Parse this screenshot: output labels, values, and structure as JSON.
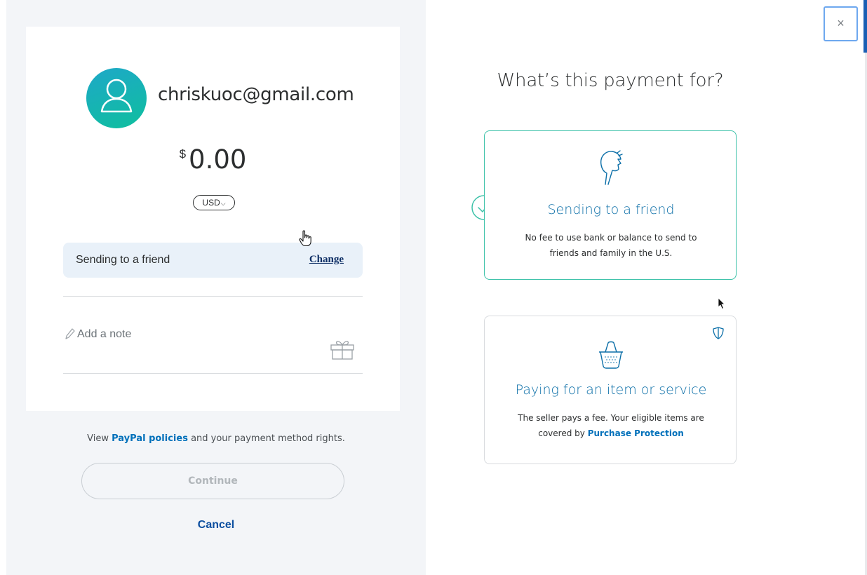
{
  "recipient": {
    "email": "chriskuoc@gmail.com"
  },
  "payment": {
    "currency_symbol": "$",
    "amount": "0.00",
    "currency": "USD"
  },
  "purpose": {
    "label": "Sending to a friend",
    "change_label": "Change"
  },
  "note": {
    "placeholder": "Add a note"
  },
  "footer": {
    "policy_prefix": "View ",
    "policy_link": "PayPal policies",
    "policy_suffix": " and your payment method rights.",
    "continue_label": "Continue",
    "cancel_label": "Cancel"
  },
  "purpose_picker": {
    "title": "What’s this payment for?",
    "options": [
      {
        "title": "Sending to a friend",
        "description_line1": "No fee to use bank or balance to send to",
        "description_line2": "friends and family in the U.S.",
        "selected": true,
        "icon": "friend-head-icon"
      },
      {
        "title": "Paying for an item or service",
        "description_line1": "The seller pays a fee. Your eligible items are",
        "description_line2_prefix": "covered by ",
        "description_link": "Purchase Protection",
        "selected": false,
        "icon": "shopping-basket-icon"
      }
    ]
  },
  "close_label": "×",
  "colors": {
    "accent_blue": "#0070ba",
    "teal_selected": "#3dc2a9",
    "panel_bg": "#f3f5f8",
    "purpose_row_bg": "#e9f1f9"
  }
}
